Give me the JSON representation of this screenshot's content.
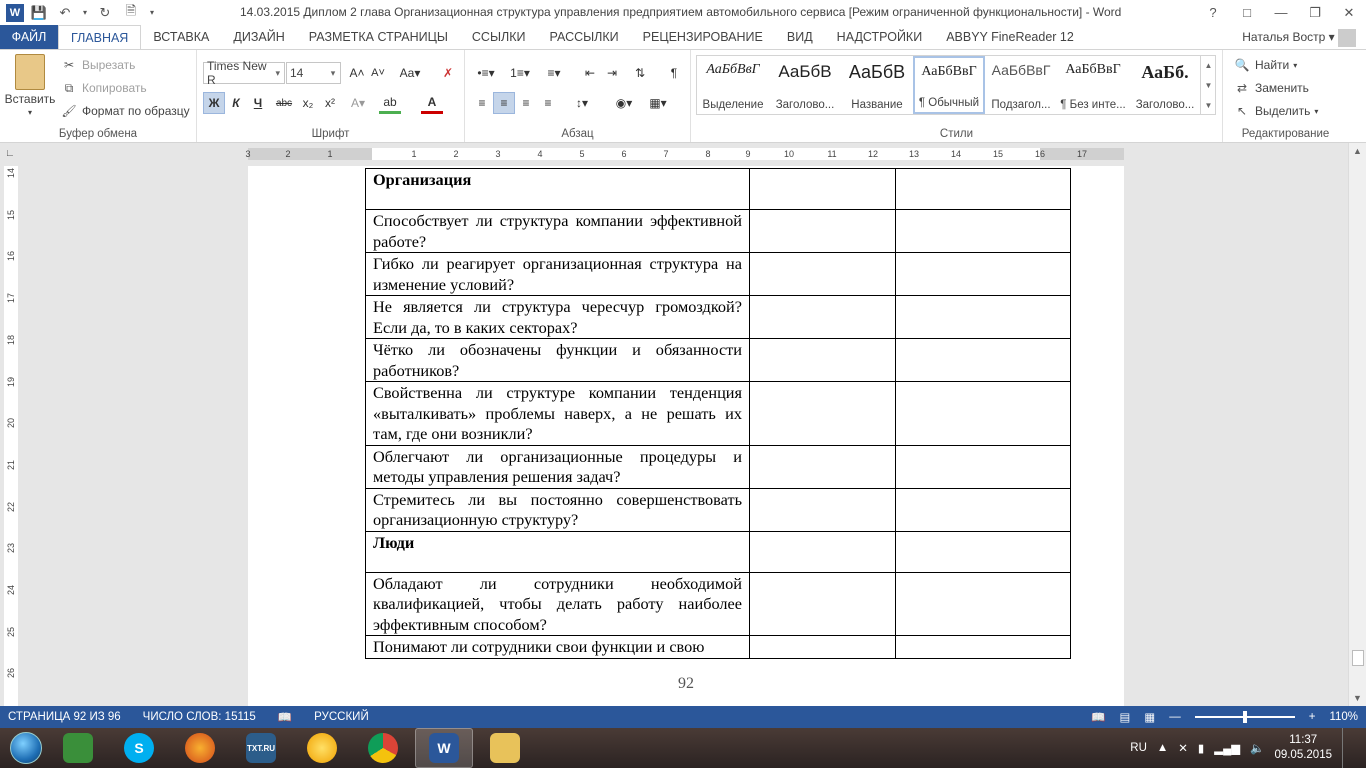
{
  "window": {
    "title": "14.03.2015 Диплом 2 глава Организационная структура управления предприятием автомобильного сервиса [Режим ограниченной функциональности] - Word",
    "user": "Наталья Востр"
  },
  "tabs": [
    "ФАЙЛ",
    "ГЛАВНАЯ",
    "ВСТАВКА",
    "ДИЗАЙН",
    "РАЗМЕТКА СТРАНИЦЫ",
    "ССЫЛКИ",
    "РАССЫЛКИ",
    "РЕЦЕНЗИРОВАНИЕ",
    "ВИД",
    "НАДСТРОЙКИ",
    "ABBYY FineReader 12"
  ],
  "ribbon": {
    "clipboard": {
      "paste": "Вставить",
      "cut": "Вырезать",
      "copy": "Копировать",
      "format_painter": "Формат по образцу",
      "label": "Буфер обмена"
    },
    "font": {
      "name": "Times New R",
      "size": "14",
      "label": "Шрифт",
      "bold": "Ж",
      "italic": "К",
      "underline": "Ч",
      "strike": "abc",
      "sub": "x₂",
      "sup": "x²"
    },
    "paragraph": {
      "label": "Абзац"
    },
    "styles": {
      "label": "Стили",
      "items": [
        {
          "sample": "АаБбВвГ",
          "name": "Выделение"
        },
        {
          "sample": "АаБбВ",
          "name": "Заголово..."
        },
        {
          "sample": "АаБбВ",
          "name": "Название"
        },
        {
          "sample": "АаБбВвГ",
          "name": "¶ Обычный"
        },
        {
          "sample": "АаБбВвГ",
          "name": "Подзагол..."
        },
        {
          "sample": "АаБбВвГ",
          "name": "¶ Без инте..."
        },
        {
          "sample": "АаБб.",
          "name": "Заголово..."
        }
      ]
    },
    "editing": {
      "find": "Найти",
      "replace": "Заменить",
      "select": "Выделить",
      "label": "Редактирование"
    }
  },
  "ruler": {
    "h_labels": [
      "3",
      "2",
      "1",
      "1",
      "2",
      "3",
      "4",
      "5",
      "6",
      "7",
      "8",
      "9",
      "10",
      "11",
      "12",
      "13",
      "14",
      "15",
      "16",
      "17"
    ],
    "v_labels": [
      "14",
      "15",
      "16",
      "17",
      "18",
      "19",
      "20",
      "21",
      "22",
      "23",
      "24",
      "25",
      "26"
    ]
  },
  "document": {
    "rows": [
      {
        "text": "Организация",
        "head": true,
        "h": 41
      },
      {
        "text": "Способствует ли структура компании эффективной работе?",
        "head": false,
        "h": 41
      },
      {
        "text": "Гибко ли реагирует организационная структура на изменение условий?",
        "head": false,
        "h": 41
      },
      {
        "text": "Не является ли структура чересчур громоздкой? Если да, то в каких секторах?",
        "head": false,
        "h": 41
      },
      {
        "text": "Чётко ли обозначены функции и обязанности работников?",
        "head": false,
        "h": 41
      },
      {
        "text": "Свойственна ли структуре компании тенденция «выталкивать» проблемы наверх, а не решать их там, где они возникли?",
        "head": false,
        "h": 62
      },
      {
        "text": "Облегчают ли организационные процедуры и методы управления решения задач?",
        "head": false,
        "h": 41
      },
      {
        "text": "Стремитесь ли вы постоянно совершенствовать организационную структуру?",
        "head": false,
        "h": 41
      },
      {
        "text": "Люди",
        "head": true,
        "h": 41
      },
      {
        "text": "Обладают ли сотрудники необходимой квалификацией, чтобы делать работу наиболее эффективным способом?",
        "head": false,
        "h": 62
      },
      {
        "text": "Понимают ли сотрудники свои функции и свою",
        "head": false,
        "h": 21
      }
    ],
    "page_number": "92"
  },
  "status": {
    "page": "СТРАНИЦА 92 ИЗ 96",
    "words": "ЧИСЛО СЛОВ: 15115",
    "language": "РУССКИЙ",
    "zoom": "110%",
    "zoom_level": 0.5
  },
  "taskbar": {
    "apps": [
      "",
      "S",
      "",
      "TXT.RU",
      "",
      "",
      "W",
      ""
    ],
    "lang": "RU",
    "time": "11:37",
    "date": "09.05.2015"
  },
  "colors": {
    "accent": "#2b579a"
  }
}
